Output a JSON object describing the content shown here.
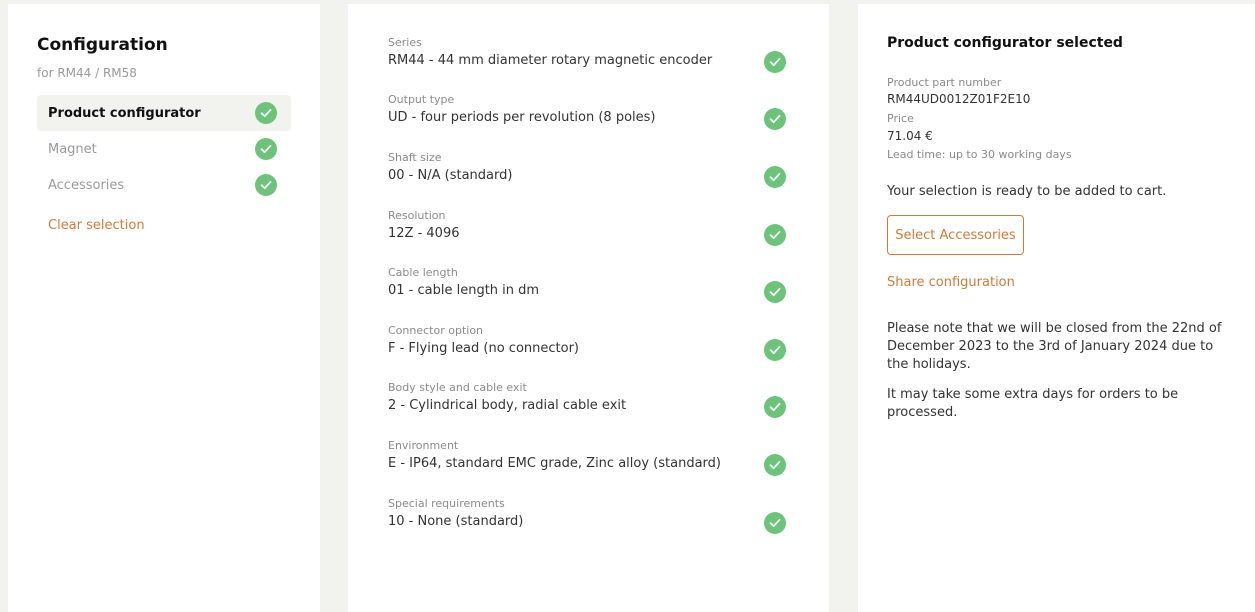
{
  "sidebar": {
    "title": "Configuration",
    "subtitle": "for RM44 / RM58",
    "steps": [
      {
        "label": "Product configurator",
        "active": true
      },
      {
        "label": "Magnet",
        "active": false
      },
      {
        "label": "Accessories",
        "active": false
      }
    ],
    "clear_label": "Clear selection"
  },
  "options": [
    {
      "label": "Series",
      "value": "RM44 - 44 mm diameter rotary magnetic encoder"
    },
    {
      "label": "Output type",
      "value": "UD - four periods per revolution (8 poles)"
    },
    {
      "label": "Shaft size",
      "value": "00 - N/A (standard)"
    },
    {
      "label": "Resolution",
      "value": "12Z - 4096"
    },
    {
      "label": "Cable length",
      "value": "01 - cable length in dm"
    },
    {
      "label": "Connector option",
      "value": "F - Flying lead (no connector)"
    },
    {
      "label": "Body style and cable exit",
      "value": "2 - Cylindrical body, radial cable exit"
    },
    {
      "label": "Environment",
      "value": "E - IP64, standard EMC grade, Zinc alloy (standard)"
    },
    {
      "label": "Special requirements",
      "value": "10 - None (standard)"
    }
  ],
  "summary": {
    "title": "Product configurator selected",
    "part_label": "Product part number",
    "part_number": "RM44UD0012Z01F2E10",
    "price_label": "Price",
    "price": "71.04 €",
    "lead_time": "Lead time: up to 30 working days",
    "ready_text": "Your selection is ready to be added to cart.",
    "accessories_button": "Select Accessories",
    "share_label": "Share configuration",
    "notice": "Please note that we will be closed from the 22nd of December 2023 to the 3rd of January 2024 due to the holidays.",
    "notice2": "It may take some extra days for orders to be processed."
  },
  "colors": {
    "accent": "#d07a3a",
    "check": "#6cc47a",
    "background": "#f2f2ee"
  }
}
